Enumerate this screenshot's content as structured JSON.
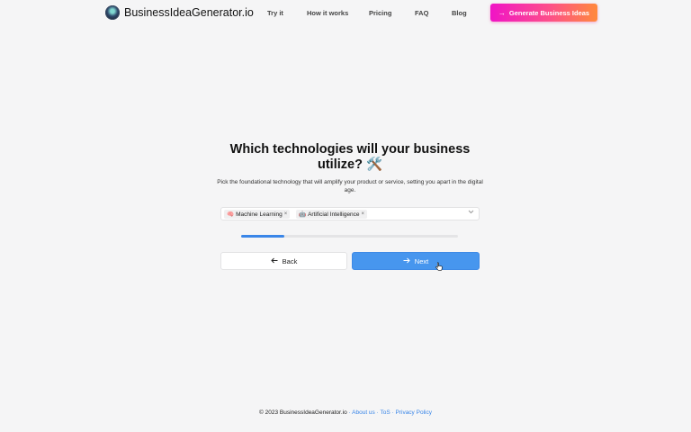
{
  "brand": {
    "name": "BusinessIdeaGenerator.io"
  },
  "nav": {
    "links": [
      "Try it",
      "How it works",
      "Pricing",
      "FAQ",
      "Blog"
    ],
    "cta": "Generate Business Ideas"
  },
  "main": {
    "question": "Which technologies will your business utilize? 🛠️",
    "subtitle": "Pick the foundational technology that will amplify your product or service, setting you apart in the digital age.",
    "selected": [
      {
        "emoji": "🧠",
        "label": "Machine Learning"
      },
      {
        "emoji": "🤖",
        "label": "Artificial Intelligence"
      }
    ],
    "remove_glyph": "×",
    "input_value": "",
    "progress": 0.2,
    "back_label": "Back",
    "next_label": "Next"
  },
  "footer": {
    "copyright": "© 2023 BusinessIdeaGenerator.io",
    "sep": "·",
    "links": [
      "About us",
      "ToS",
      "Privacy Policy"
    ]
  },
  "colors": {
    "accent": "#4796ee",
    "cta_start": "#f014c6",
    "cta_end": "#ff8a3d",
    "background": "#f5f5f6"
  },
  "icons": {
    "logo": "lightbulb-head-icon",
    "cta": "arrow-right-icon",
    "back": "arrow-left-icon",
    "next": "arrow-right-icon",
    "dropdown": "chevron-down-icon",
    "pointer": "hand-pointer-cursor-icon"
  }
}
